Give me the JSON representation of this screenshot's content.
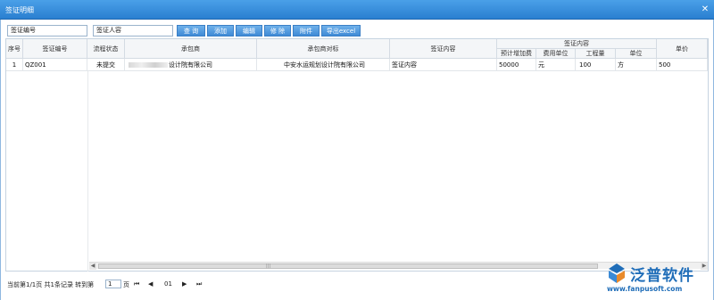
{
  "window": {
    "title": "签证明细",
    "close_glyph": "✕"
  },
  "toolbar": {
    "code_input_value": "签证编号",
    "person_input_value": "签证人容",
    "buttons": [
      "查 询",
      "添加",
      "编辑",
      "修 除",
      "附件",
      "导出excel"
    ]
  },
  "grid": {
    "headers": {
      "seq": "序号",
      "code": "签证编号",
      "flow": "流程状态",
      "contractor": "承包商",
      "counterparty": "承包商对标",
      "content": "签证内容",
      "group": "签证内容",
      "sub_amount": "预计增加费",
      "sub_unit": "费用单位",
      "sub_qty": "工程量",
      "sub_measure": "单位",
      "price": "单价"
    },
    "rows": [
      {
        "seq": "1",
        "code": "QZ001",
        "flow": "未提交",
        "contractor": "设计院有限公司",
        "counterparty": "中安水运规划设计院有限公司",
        "content": "签证内容",
        "amount": "50000",
        "unit": "元",
        "qty": "100",
        "measure": "方",
        "price": "500"
      }
    ]
  },
  "pager": {
    "summary": "当前第1/1页 共1条记录 转到第",
    "page_input": "1",
    "page_suffix": "页",
    "current_page": "01"
  },
  "logo": {
    "name": "泛普软件",
    "url": "www.fanpusoft.com"
  },
  "colors": {
    "title_bar": "#2a7fd0",
    "button": "#4a90d9",
    "brand": "#1f6db8"
  }
}
